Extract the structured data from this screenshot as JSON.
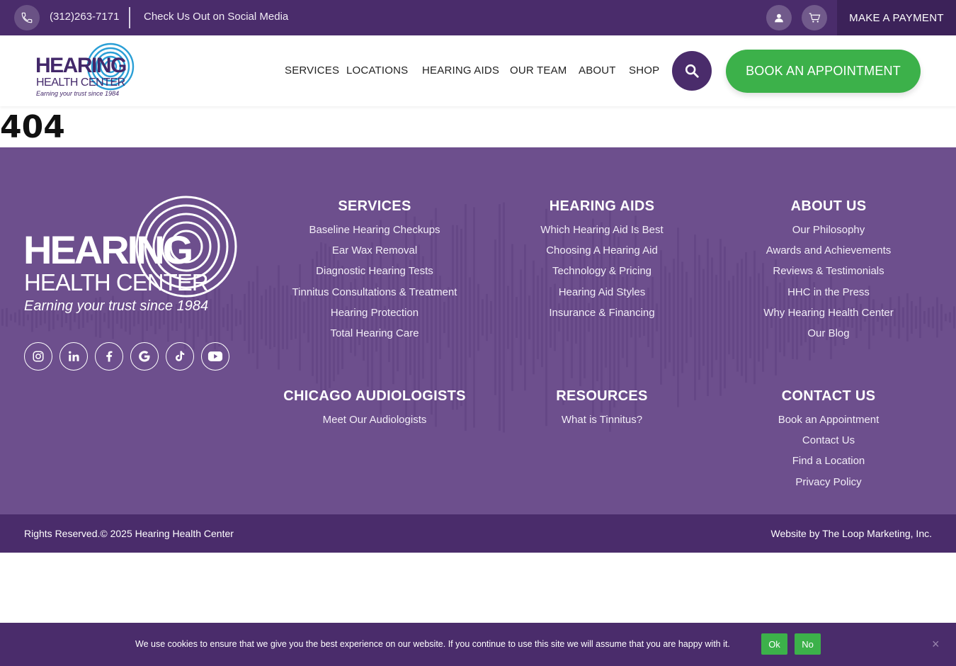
{
  "topbar": {
    "phone": "(312)263-7171",
    "social": "Check Us Out on Social Media",
    "payment": "MAKE A PAYMENT",
    "icons": [
      "phone-icon",
      "user-icon",
      "cart-icon"
    ]
  },
  "header": {
    "logo": {
      "line1": "HEARING",
      "line2": "HEALTH CENTER",
      "line3": "Earning your trust since 1984"
    },
    "nav": [
      "SERVICES",
      "LOCATIONS",
      "HEARING AIDS",
      "OUR TEAM",
      "ABOUT",
      "SHOP"
    ],
    "book": "BOOK AN APPOINTMENT"
  },
  "main": {
    "error_code": "404"
  },
  "footer": {
    "logo": {
      "line1": "HEARING",
      "line2": "HEALTH CENTER",
      "line3": "Earning your trust since 1984"
    },
    "social_icons": [
      "instagram-icon",
      "linkedin-icon",
      "facebook-icon",
      "google-icon",
      "tiktok-icon",
      "youtube-icon"
    ],
    "columns": [
      {
        "title": "SERVICES",
        "links": [
          "Baseline Hearing Checkups",
          "Ear Wax Removal",
          "Diagnostic Hearing Tests",
          "Tinnitus Consultations & Treatment",
          "Hearing Protection",
          "Total Hearing Care"
        ]
      },
      {
        "title": "HEARING AIDS",
        "links": [
          "Which Hearing Aid Is Best",
          "Choosing A Hearing Aid",
          "Technology & Pricing",
          "Hearing Aid Styles",
          "Insurance & Financing"
        ]
      },
      {
        "title": "ABOUT US",
        "links": [
          "Our Philosophy",
          "Awards and Achievements",
          "Reviews & Testimonials",
          "HHC in the Press",
          "Why Hearing Health Center",
          "Our Blog"
        ]
      },
      {
        "title": "CHICAGO AUDIOLOGISTS",
        "links": [
          "Meet Our Audiologists"
        ]
      },
      {
        "title": "RESOURCES",
        "links": [
          "What is Tinnitus?"
        ]
      },
      {
        "title": "CONTACT US",
        "links": [
          "Book an Appointment",
          "Contact Us",
          "Find a Location",
          "Privacy Policy"
        ]
      }
    ],
    "copyright": "Rights Reserved.© 2025 Hearing Health Center",
    "credit": "Website by The Loop Marketing, Inc."
  },
  "cookie": {
    "message": "We use cookies to ensure that we give you the best experience on our website. If you continue to use this site we will assume that you are happy with it.",
    "ok": "Ok",
    "no": "No",
    "close": "×"
  },
  "colors": {
    "brand_purple": "#4a2c6b",
    "footer_purple": "#6d4f8d",
    "accent_green": "#3cb14a"
  }
}
